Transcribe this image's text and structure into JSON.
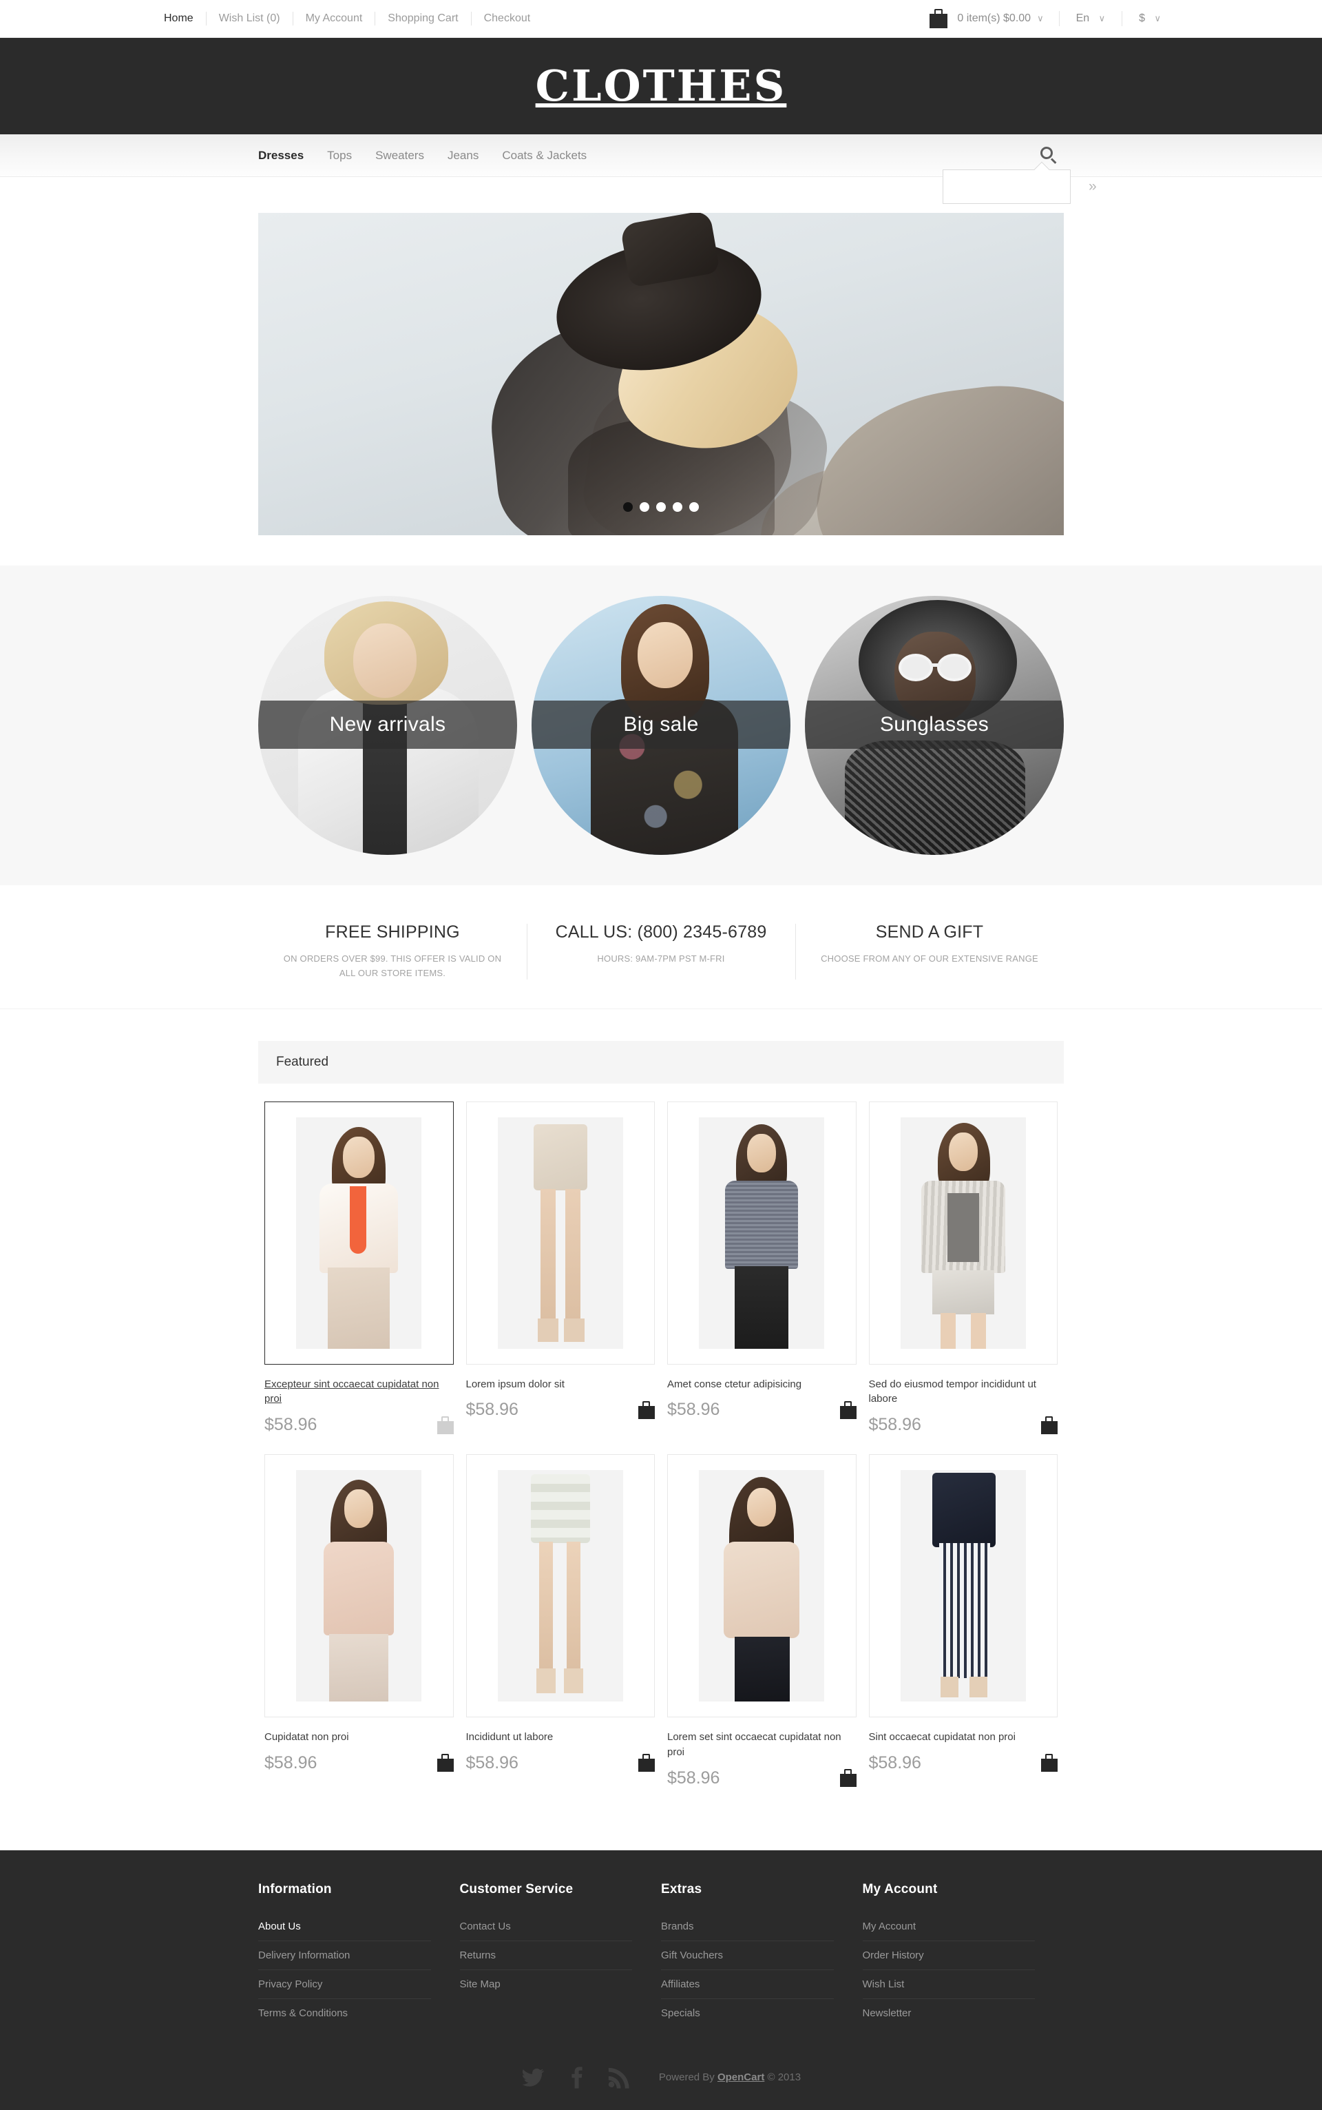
{
  "topbar": {
    "links": [
      {
        "label": "Home",
        "active": true
      },
      {
        "label": "Wish List (0)",
        "active": false
      },
      {
        "label": "My Account",
        "active": false
      },
      {
        "label": "Shopping Cart",
        "active": false
      },
      {
        "label": "Checkout",
        "active": false
      }
    ],
    "cart_text": "0 item(s) $0.00",
    "cart_caret": "∨",
    "language": "En",
    "language_caret": "∨",
    "currency": "$",
    "currency_caret": "∨"
  },
  "header": {
    "logo": "CLOTHES"
  },
  "nav": {
    "items": [
      {
        "label": "Dresses",
        "active": true
      },
      {
        "label": "Tops",
        "active": false
      },
      {
        "label": "Sweaters",
        "active": false
      },
      {
        "label": "Jeans",
        "active": false
      },
      {
        "label": "Coats & Jackets",
        "active": false
      }
    ],
    "search": {
      "value": "",
      "placeholder": "",
      "submit_label": "»"
    }
  },
  "hero": {
    "slides_count": 5,
    "active_slide": 1
  },
  "categories": [
    {
      "label": "New arrivals"
    },
    {
      "label": "Big sale"
    },
    {
      "label": "Sunglasses"
    }
  ],
  "services": [
    {
      "title": "FREE SHIPPING",
      "text": "ON ORDERS OVER $99. THIS OFFER IS VALID ON ALL OUR STORE ITEMS."
    },
    {
      "title": "CALL US: (800) 2345-6789",
      "text": "HOURS: 9AM-7PM PST M-FRI"
    },
    {
      "title": "SEND A GIFT",
      "text": "CHOOSE FROM ANY OF OUR EXTENSIVE RANGE"
    }
  ],
  "featured": {
    "heading": "Featured",
    "products": [
      {
        "name": "Excepteur sint occaecat cupidatat non proi",
        "price": "$58.96",
        "hovered": true
      },
      {
        "name": "Lorem ipsum dolor sit",
        "price": "$58.96",
        "hovered": false
      },
      {
        "name": "Amet conse ctetur adipisicing",
        "price": "$58.96",
        "hovered": false
      },
      {
        "name": "Sed do eiusmod tempor incididunt ut labore",
        "price": "$58.96",
        "hovered": false
      },
      {
        "name": "Cupidatat non proi",
        "price": "$58.96",
        "hovered": false
      },
      {
        "name": "Incididunt ut labore",
        "price": "$58.96",
        "hovered": false
      },
      {
        "name": "Lorem set sint occaecat cupidatat non proi",
        "price": "$58.96",
        "hovered": false
      },
      {
        "name": "Sint occaecat cupidatat non proi",
        "price": "$58.96",
        "hovered": false
      }
    ]
  },
  "footer": {
    "columns": [
      {
        "title": "Information",
        "links": [
          {
            "label": "About Us",
            "active": true
          },
          {
            "label": "Delivery Information",
            "active": false
          },
          {
            "label": "Privacy Policy",
            "active": false
          },
          {
            "label": "Terms & Conditions",
            "active": false
          }
        ]
      },
      {
        "title": "Customer Service",
        "links": [
          {
            "label": "Contact Us",
            "active": false
          },
          {
            "label": "Returns",
            "active": false
          },
          {
            "label": "Site Map",
            "active": false
          }
        ]
      },
      {
        "title": "Extras",
        "links": [
          {
            "label": "Brands",
            "active": false
          },
          {
            "label": "Gift Vouchers",
            "active": false
          },
          {
            "label": "Affiliates",
            "active": false
          },
          {
            "label": "Specials",
            "active": false
          }
        ]
      },
      {
        "title": "My Account",
        "links": [
          {
            "label": "My Account",
            "active": false
          },
          {
            "label": "Order History",
            "active": false
          },
          {
            "label": "Wish List",
            "active": false
          },
          {
            "label": "Newsletter",
            "active": false
          }
        ]
      }
    ],
    "socials": [
      "twitter-icon",
      "facebook-icon",
      "rss-icon"
    ],
    "powered_prefix": "Powered By ",
    "powered_brand": "OpenCart",
    "powered_suffix": " © 2013"
  },
  "colors": {
    "dark": "#2b2b2b",
    "panel": "#f5f5f5",
    "muted": "#9c9c9c"
  }
}
